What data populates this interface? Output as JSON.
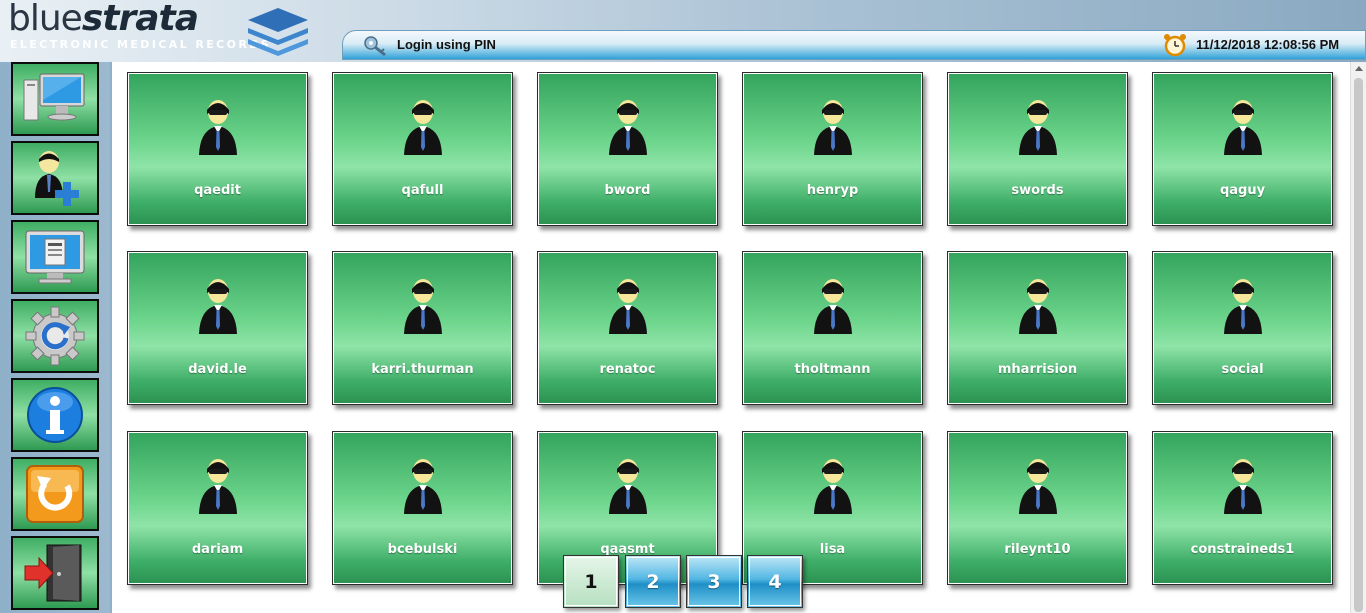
{
  "header": {
    "logo_light": "blue",
    "logo_bold": "strata",
    "tagline": "ELECTRONIC MEDICAL RECORDS",
    "logo_icon": "stacked-layers-icon"
  },
  "statusbar": {
    "login_label": "Login using PIN",
    "login_icon": "key-icon",
    "datetime": "11/12/2018 12:08:56 PM",
    "clock_icon": "alarm-clock-icon"
  },
  "sidebar": {
    "items": [
      {
        "icon": "computer-icon"
      },
      {
        "icon": "add-user-icon"
      },
      {
        "icon": "monitor-form-icon"
      },
      {
        "icon": "refresh-gear-icon"
      },
      {
        "icon": "info-icon"
      },
      {
        "icon": "reload-icon"
      },
      {
        "icon": "exit-door-icon"
      }
    ]
  },
  "users": [
    {
      "name": "qaedit"
    },
    {
      "name": "qafull"
    },
    {
      "name": "bword"
    },
    {
      "name": "henryp"
    },
    {
      "name": "swords"
    },
    {
      "name": "qaguy"
    },
    {
      "name": "david.le"
    },
    {
      "name": "karri.thurman"
    },
    {
      "name": "renatoc"
    },
    {
      "name": "tholtmann"
    },
    {
      "name": "mharrision"
    },
    {
      "name": "social"
    },
    {
      "name": "dariam"
    },
    {
      "name": "bcebulski"
    },
    {
      "name": "qaasmt"
    },
    {
      "name": "lisa"
    },
    {
      "name": "rileynt10"
    },
    {
      "name": "constraineds1"
    }
  ],
  "pager": {
    "pages": [
      "1",
      "2",
      "3",
      "4"
    ],
    "current": "1"
  },
  "colors": {
    "tile_green": "#4cc476",
    "pager_blue": "#2fa2d8",
    "header_blue": "#8aa9c1"
  }
}
